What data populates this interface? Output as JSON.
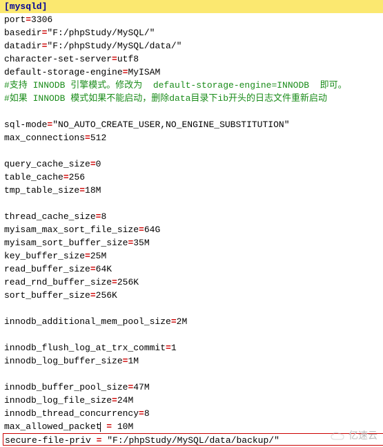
{
  "config": {
    "section": "[mysqld]",
    "lines": [
      {
        "type": "kv",
        "key": "port",
        "val": "3306"
      },
      {
        "type": "kv",
        "key": "basedir",
        "val": "\"F:/phpStudy/MySQL/\""
      },
      {
        "type": "kv",
        "key": "datadir",
        "val": "\"F:/phpStudy/MySQL/data/\""
      },
      {
        "type": "kv",
        "key": "character-set-server",
        "val": "utf8"
      },
      {
        "type": "kv",
        "key": "default-storage-engine",
        "val": "MyISAM"
      },
      {
        "type": "comment",
        "text": "#支持 INNODB 引擎模式。修改为  default-storage-engine=INNODB  即可。"
      },
      {
        "type": "comment",
        "text": "#如果 INNODB 模式如果不能启动，删除data目录下ib开头的日志文件重新启动"
      },
      {
        "type": "blank"
      },
      {
        "type": "kv",
        "key": "sql-mode",
        "val": "\"NO_AUTO_CREATE_USER,NO_ENGINE_SUBSTITUTION\""
      },
      {
        "type": "kv",
        "key": "max_connections",
        "val": "512"
      },
      {
        "type": "blank"
      },
      {
        "type": "kv",
        "key": "query_cache_size",
        "val": "0"
      },
      {
        "type": "kv",
        "key": "table_cache",
        "val": "256"
      },
      {
        "type": "kv",
        "key": "tmp_table_size",
        "val": "18M"
      },
      {
        "type": "blank"
      },
      {
        "type": "kv",
        "key": "thread_cache_size",
        "val": "8"
      },
      {
        "type": "kv",
        "key": "myisam_max_sort_file_size",
        "val": "64G"
      },
      {
        "type": "kv",
        "key": "myisam_sort_buffer_size",
        "val": "35M"
      },
      {
        "type": "kv",
        "key": "key_buffer_size",
        "val": "25M"
      },
      {
        "type": "kv",
        "key": "read_buffer_size",
        "val": "64K"
      },
      {
        "type": "kv",
        "key": "read_rnd_buffer_size",
        "val": "256K"
      },
      {
        "type": "kv",
        "key": "sort_buffer_size",
        "val": "256K"
      },
      {
        "type": "blank"
      },
      {
        "type": "kv",
        "key": "innodb_additional_mem_pool_size",
        "val": "2M"
      },
      {
        "type": "blank"
      },
      {
        "type": "kv",
        "key": "innodb_flush_log_at_trx_commit",
        "val": "1"
      },
      {
        "type": "kv",
        "key": "innodb_log_buffer_size",
        "val": "1M"
      },
      {
        "type": "blank"
      },
      {
        "type": "kv",
        "key": "innodb_buffer_pool_size",
        "val": "47M"
      },
      {
        "type": "kv",
        "key": "innodb_log_file_size",
        "val": "24M"
      },
      {
        "type": "kv",
        "key": "innodb_thread_concurrency",
        "val": "8"
      },
      {
        "type": "kv_cursor",
        "key": "max_allowed_packet",
        "val": " 10M",
        "spaced": true
      },
      {
        "type": "boxed",
        "key": "secure-file-priv",
        "val": "\"F:/phpStudy/MySQL/data/backup/\""
      }
    ]
  },
  "watermark": "亿速云"
}
